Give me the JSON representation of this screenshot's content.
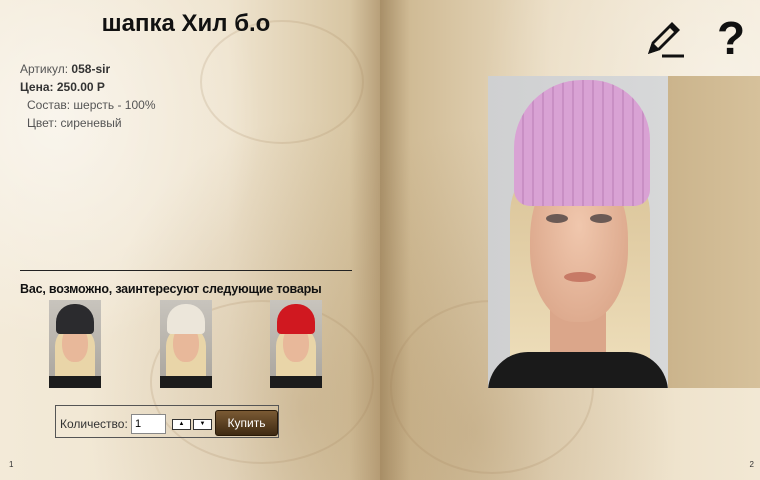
{
  "product": {
    "title": "шапка Хил б.о",
    "sku_label": "Артикул:",
    "sku_value": "058-sir",
    "price_label": "Цена:",
    "price_value": "250.00 Р",
    "composition": "Состав: шерсть - 100%",
    "color": "Цвет: сиреневый"
  },
  "related": {
    "title": "Вас, возможно, заинтересуют следующие товары",
    "items": [
      {
        "hat_color": "#2b2b2e"
      },
      {
        "hat_color": "#ece6da"
      },
      {
        "hat_color": "#d01820"
      }
    ]
  },
  "order": {
    "quantity_label": "Количество:",
    "quantity_value": "1",
    "up_label": "▲",
    "down_label": "▼",
    "buy_label": "Купить"
  },
  "pages": {
    "left_number": "1",
    "right_number": "2"
  },
  "icons": {
    "edit": "pencil-edit-icon",
    "help": "?"
  },
  "colors": {
    "buy_button": "#5a3e1e",
    "main_hat": "#d9a2d4"
  }
}
